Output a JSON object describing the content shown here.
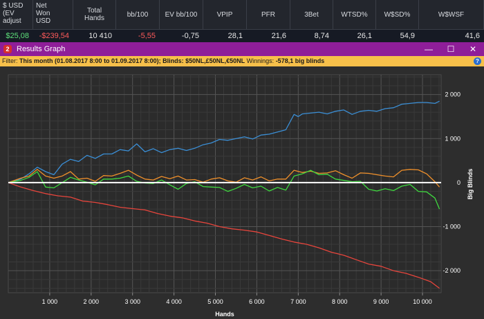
{
  "stats": {
    "headers": [
      "$ USD\n(EV\nadjust",
      "Net\nWon\nUSD",
      "Total\nHands",
      "bb/100",
      "EV bb/100",
      "VPIP",
      "PFR",
      "3Bet",
      "WTSD%",
      "W$SD%",
      "W$WSF"
    ],
    "values": [
      "$25,08",
      "-$239,54",
      "10 410",
      "-5,55",
      "-0,75",
      "28,1",
      "21,6",
      "8,74",
      "26,1",
      "54,9",
      "41,6"
    ],
    "value_colors": [
      "#5ee07a",
      "#ff5a5a",
      "#e8e8e8",
      "#ff5a5a",
      "#e8e8e8",
      "#e8e8e8",
      "#e8e8e8",
      "#e8e8e8",
      "#e8e8e8",
      "#e8e8e8",
      "#e8e8e8"
    ]
  },
  "window": {
    "title": "Results Graph",
    "icon_label": "2",
    "minimize": "—",
    "maximize": "☐",
    "close": "✕"
  },
  "filter": {
    "prefix": "Filter: ",
    "text": "This month (01.08.2017 8:00 to 01.09.2017 8:00); Blinds: $50NL,£50NL,€50NL",
    "winnings_label": " Winnings: ",
    "winnings_value": "-578,1 big blinds",
    "help": "?"
  },
  "chart_data": {
    "type": "line",
    "xlabel": "Hands",
    "ylabel": "Big Blinds",
    "xlim": [
      0,
      10450
    ],
    "ylim": [
      -2500,
      2450
    ],
    "xticks": [
      1000,
      2000,
      3000,
      4000,
      5000,
      6000,
      7000,
      8000,
      9000,
      10000
    ],
    "xtick_labels": [
      "1 000",
      "2 000",
      "3 000",
      "4 000",
      "5 000",
      "6 000",
      "7 000",
      "8 000",
      "9 000",
      "10 000"
    ],
    "yticks": [
      2000,
      1000,
      0,
      -1000,
      -2000
    ],
    "ytick_labels": [
      "2 000",
      "1 000",
      "0",
      "-1 000",
      "-2 000"
    ],
    "grid": true,
    "zero_line_color": "#ffffff",
    "series": [
      {
        "color": "#3b8fd6",
        "x": [
          0,
          300,
          500,
          700,
          900,
          1100,
          1300,
          1500,
          1700,
          1900,
          2100,
          2300,
          2500,
          2700,
          2900,
          3100,
          3300,
          3500,
          3700,
          3900,
          4100,
          4300,
          4500,
          4700,
          4900,
          5100,
          5300,
          5500,
          5700,
          5900,
          6100,
          6300,
          6500,
          6700,
          6900,
          7000,
          7100,
          7300,
          7500,
          7700,
          7900,
          8100,
          8300,
          8500,
          8700,
          8900,
          9100,
          9300,
          9500,
          9700,
          9900,
          10100,
          10300,
          10410
        ],
        "y": [
          0,
          80,
          200,
          350,
          250,
          180,
          420,
          530,
          480,
          620,
          550,
          650,
          650,
          750,
          720,
          880,
          700,
          770,
          680,
          750,
          780,
          730,
          780,
          860,
          900,
          980,
          960,
          1000,
          1040,
          990,
          1080,
          1100,
          1150,
          1200,
          1550,
          1500,
          1560,
          1580,
          1600,
          1560,
          1620,
          1650,
          1550,
          1620,
          1640,
          1620,
          1680,
          1700,
          1780,
          1800,
          1820,
          1820,
          1800,
          1850
        ]
      },
      {
        "color": "#f0902a",
        "x": [
          0,
          300,
          500,
          700,
          900,
          1100,
          1300,
          1500,
          1700,
          1900,
          2100,
          2300,
          2500,
          2700,
          2900,
          3100,
          3300,
          3500,
          3700,
          3900,
          4100,
          4300,
          4500,
          4700,
          4900,
          5100,
          5300,
          5500,
          5700,
          5900,
          6100,
          6300,
          6500,
          6700,
          6900,
          7100,
          7300,
          7500,
          7700,
          7900,
          8100,
          8300,
          8500,
          8700,
          8900,
          9100,
          9300,
          9500,
          9700,
          9900,
          10100,
          10300,
          10410
        ],
        "y": [
          0,
          100,
          150,
          300,
          150,
          100,
          150,
          250,
          80,
          100,
          30,
          160,
          150,
          210,
          280,
          170,
          80,
          60,
          140,
          90,
          150,
          60,
          70,
          10,
          80,
          110,
          40,
          10,
          110,
          60,
          130,
          40,
          80,
          80,
          280,
          230,
          260,
          210,
          220,
          270,
          180,
          100,
          220,
          210,
          180,
          150,
          130,
          280,
          300,
          290,
          200,
          20,
          -100
        ]
      },
      {
        "color": "#3fd93f",
        "x": [
          0,
          300,
          500,
          700,
          900,
          1100,
          1300,
          1500,
          1700,
          1900,
          2100,
          2300,
          2500,
          2700,
          2900,
          3100,
          3300,
          3500,
          3700,
          3900,
          4100,
          4300,
          4500,
          4700,
          4900,
          5100,
          5300,
          5500,
          5700,
          5900,
          6100,
          6300,
          6500,
          6700,
          6900,
          7100,
          7300,
          7500,
          7700,
          7900,
          8100,
          8300,
          8500,
          8700,
          8900,
          9100,
          9300,
          9500,
          9700,
          9900,
          10100,
          10300,
          10410
        ],
        "y": [
          0,
          50,
          120,
          250,
          -100,
          -120,
          0,
          120,
          60,
          10,
          -50,
          80,
          80,
          100,
          150,
          30,
          -10,
          -20,
          60,
          -50,
          -150,
          -20,
          20,
          -90,
          -100,
          -110,
          -200,
          -130,
          -40,
          -120,
          -80,
          -190,
          -110,
          -170,
          150,
          200,
          280,
          180,
          190,
          80,
          50,
          20,
          30,
          -150,
          -190,
          -140,
          -180,
          -80,
          -40,
          -200,
          -210,
          -350,
          -600
        ]
      },
      {
        "color": "#e8453c",
        "x": [
          0,
          300,
          600,
          900,
          1200,
          1500,
          1800,
          2100,
          2400,
          2700,
          3000,
          3300,
          3600,
          3900,
          4200,
          4500,
          4800,
          5100,
          5400,
          5700,
          6000,
          6300,
          6600,
          6900,
          7200,
          7500,
          7800,
          8100,
          8400,
          8700,
          9000,
          9300,
          9600,
          9900,
          10200,
          10410
        ],
        "y": [
          0,
          -100,
          -180,
          -250,
          -300,
          -330,
          -420,
          -450,
          -500,
          -560,
          -590,
          -620,
          -700,
          -760,
          -800,
          -870,
          -920,
          -1000,
          -1050,
          -1080,
          -1120,
          -1200,
          -1280,
          -1350,
          -1400,
          -1480,
          -1580,
          -1650,
          -1750,
          -1850,
          -1900,
          -2000,
          -2060,
          -2150,
          -2250,
          -2400
        ]
      }
    ]
  }
}
